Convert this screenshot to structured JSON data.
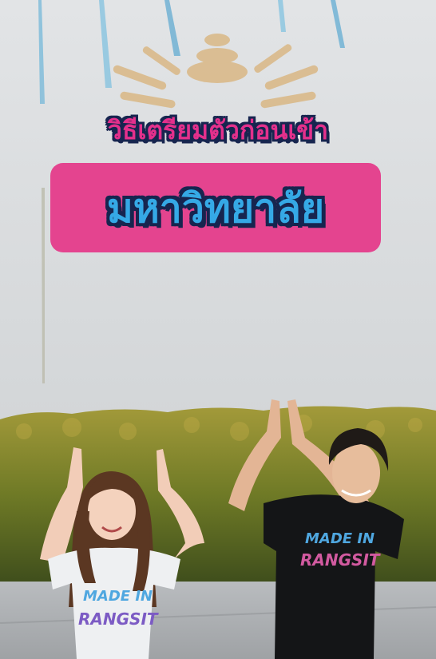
{
  "caption": {
    "line1": "วิธีเตรียมตัวก่อนเข้า",
    "line2": "มหาวิทยาลัย"
  },
  "shirt_left": {
    "line1": "MADE IN",
    "line2": "RANGSIT"
  },
  "shirt_right": {
    "line1": "MADE IN",
    "line2": "RANGSIT"
  },
  "colors": {
    "caption_pink": "#e4308c",
    "caption_outline": "#17254f",
    "banner_pink": "#e4448f",
    "banner_text_blue": "#35a9e6",
    "sky": "#d9dcde",
    "hedge": "#8a8b2a"
  }
}
